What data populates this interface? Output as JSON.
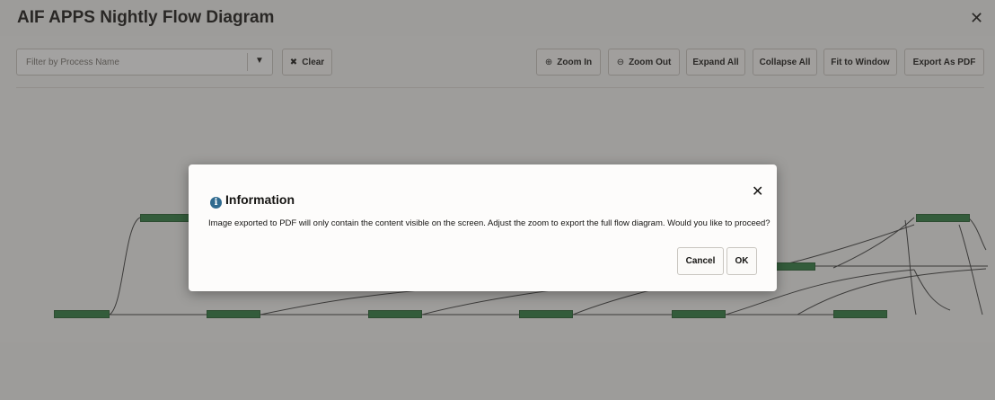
{
  "window": {
    "title": "AIF APPS Nightly Flow Diagram",
    "close_glyph": "✕"
  },
  "toolbar": {
    "filter_placeholder": "Filter by Process Name",
    "filter_caret": "▼",
    "clear_icon": "✖",
    "clear_label": "Clear",
    "zoom_in_icon": "⊕",
    "zoom_in_label": "Zoom In",
    "zoom_out_icon": "⊖",
    "zoom_out_label": "Zoom Out",
    "expand_all_label": "Expand All",
    "collapse_all_label": "Collapse All",
    "fit_to_window_label": "Fit to Window",
    "export_pdf_label": "Export As PDF"
  },
  "dialog": {
    "info_icon": "i",
    "title": "Information",
    "close_glyph": "✕",
    "message": "Image exported to PDF will only contain the content visible on the screen. Adjust the zoom to export the full flow diagram. Would you like to proceed?",
    "cancel_label": "Cancel",
    "ok_label": "OK"
  },
  "colors": {
    "node_fill": "#2a7a3c",
    "info_icon": "#2f6a8f"
  }
}
